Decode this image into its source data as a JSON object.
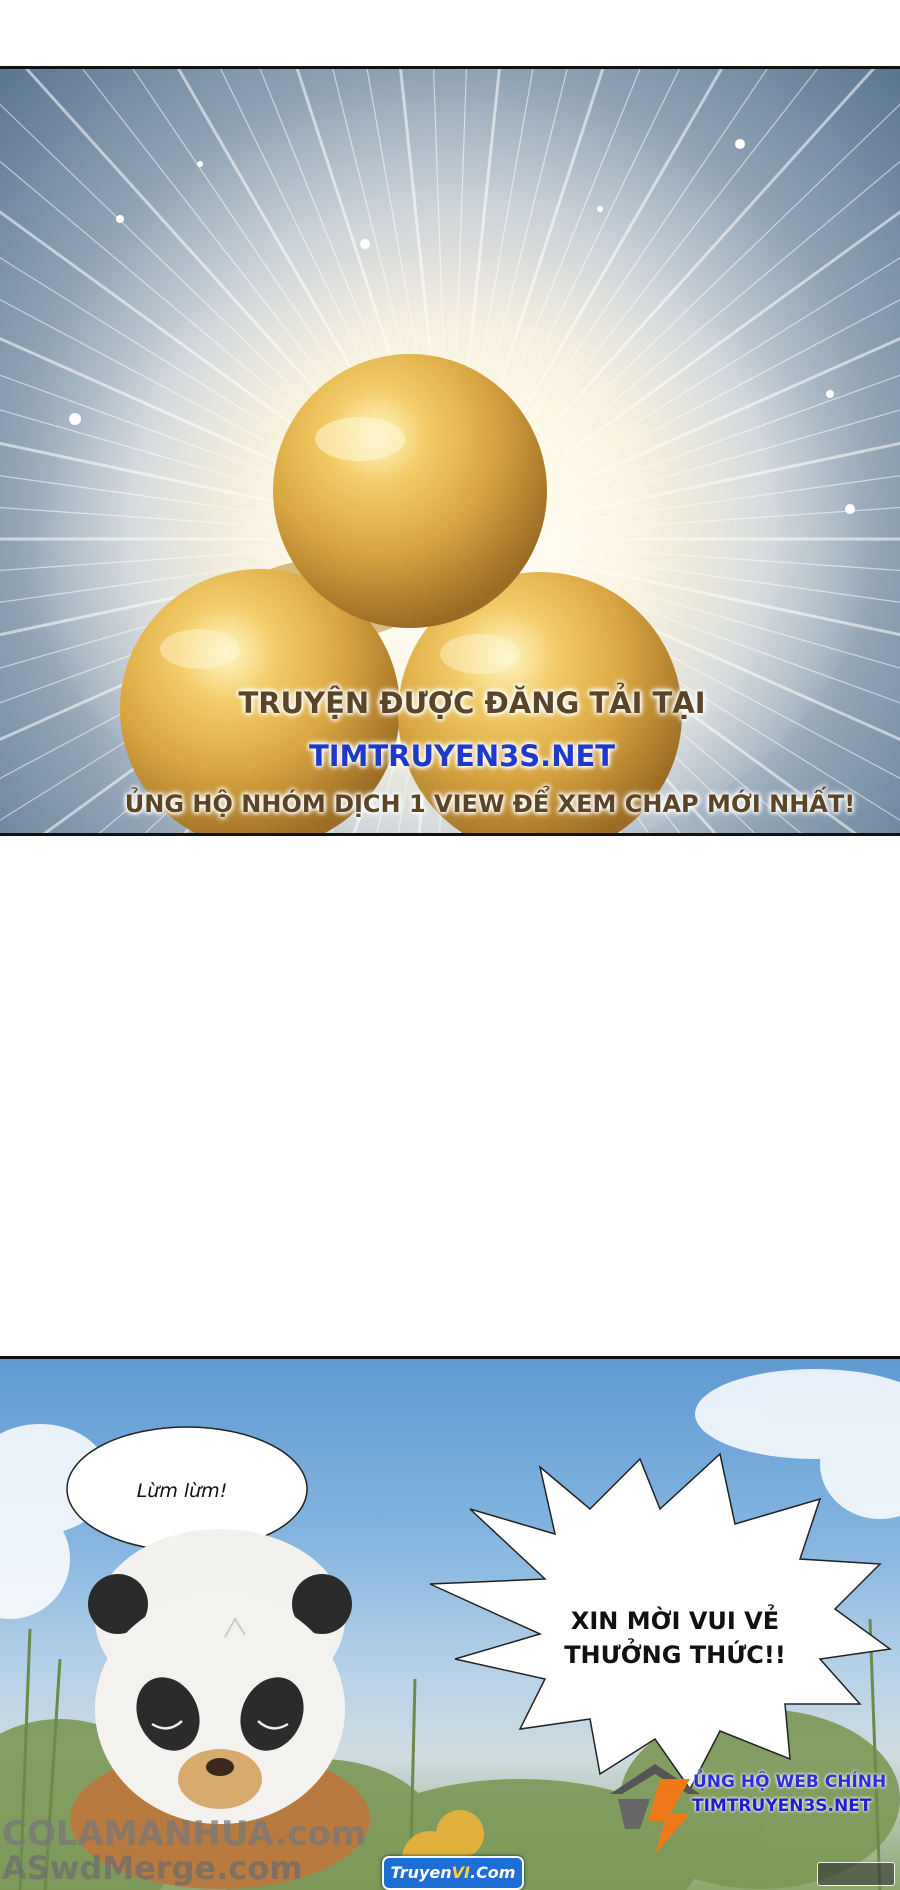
{
  "panel1": {
    "watermark": {
      "line1": "TRUYỆN ĐƯỢC ĐĂNG TẢI TẠI",
      "line2": "TIMTRUYEN3S.NET",
      "line3": "ỦNG HỘ NHÓM DỊCH 1 VIEW ĐỂ XEM CHAP MỚI NHẤT!"
    }
  },
  "panel2": {
    "bubble_small": "Lừm lừm!",
    "bubble_big_line1": "XIN MỜI VUI VẺ",
    "bubble_big_line2": "THƯỞNG THỨC!!",
    "support_label": "ỦNG HỘ WEB CHÍNH",
    "support_url": "TIMTRUYEN3S.NET",
    "watermark_cola": "COLAMANHUA.com",
    "watermark_aswd": "ASwdMerge.com",
    "badge_prefix": "Truyen",
    "badge_mid": "VI",
    "badge_suffix": ".Com"
  },
  "colors": {
    "watermark_brown": "#5b4526",
    "watermark_blue": "#1f3ac8",
    "sky": "#86b6e0",
    "pearl": "#d9a640"
  }
}
